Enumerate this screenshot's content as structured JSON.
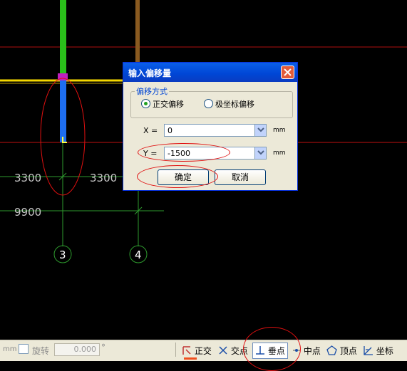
{
  "canvas": {
    "dims": [
      "3300",
      "3300",
      "9900"
    ],
    "axis_labels": [
      "3",
      "4"
    ]
  },
  "dialog": {
    "title": "输入偏移量",
    "group_label": "偏移方式",
    "radio_orthogonal": "正交偏移",
    "radio_polar": "极坐标偏移",
    "selected_mode": "正交偏移",
    "x_label": "X =",
    "x_value": "0",
    "x_unit": "mm",
    "y_label": "Y =",
    "y_value": "-1500",
    "y_unit": "mm",
    "ok_label": "确定",
    "cancel_label": "取消"
  },
  "statusbar": {
    "unit_label": "mm",
    "rotate_label": "旋转",
    "rotate_value": "0.000",
    "degree_symbol": "°",
    "snaps": [
      "正交",
      "交点",
      "垂点",
      "中点",
      "顶点",
      "坐标"
    ]
  },
  "colors": {
    "dialog_title": "#0046d5",
    "annotation": "#e01010"
  }
}
